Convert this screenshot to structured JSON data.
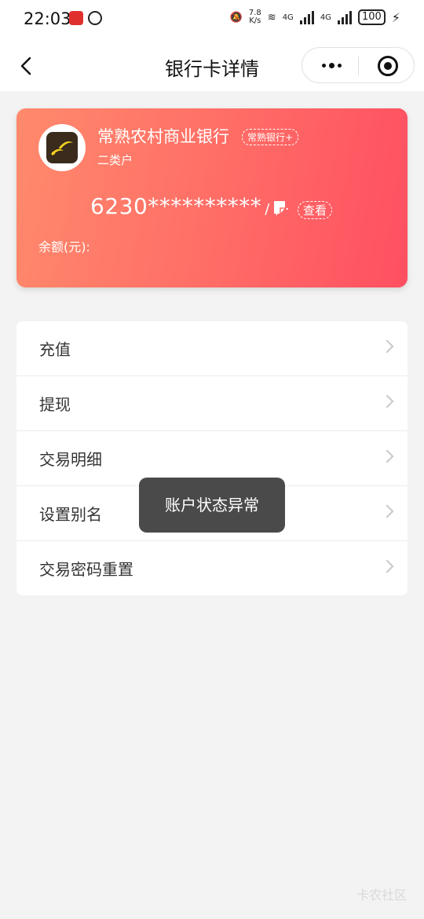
{
  "status_bar": {
    "time": "22:03",
    "net_speed_value": "7.8",
    "net_speed_unit": "K/s",
    "net_type_1": "4G",
    "net_type_2": "4G",
    "battery": "100"
  },
  "nav": {
    "title": "银行卡详情"
  },
  "card": {
    "bank_name": "常熟农村商业银行",
    "bank_tag": "常熟银行+",
    "account_type": "二类户",
    "card_number": "6230**********",
    "card_number_suffix": "/ ; ·",
    "view_label": "查看",
    "balance_label": "余额(元):",
    "gradient_start": "#ff8a6c",
    "gradient_end": "#ff4f61"
  },
  "menu": {
    "items": [
      {
        "label": "充值"
      },
      {
        "label": "提现"
      },
      {
        "label": "交易明细"
      },
      {
        "label": "设置别名"
      },
      {
        "label": "交易密码重置"
      }
    ]
  },
  "toast": {
    "message": "账户状态异常"
  },
  "watermark": "卡农社区"
}
